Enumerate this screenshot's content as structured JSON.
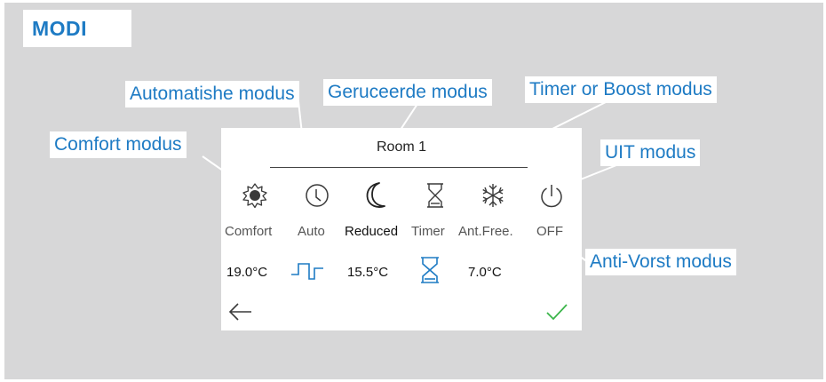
{
  "header": {
    "title": "MODI"
  },
  "callouts": {
    "comfort": "Comfort modus",
    "auto": "Automatishe modus",
    "reduced": "Geruceerde modus",
    "timer": "Timer or Boost modus",
    "off": "UIT modus",
    "antifrost": "Anti-Vorst modus"
  },
  "screen": {
    "room_title": "Room 1",
    "modes": [
      {
        "id": "comfort",
        "label": "Comfort",
        "icon": "sun-icon"
      },
      {
        "id": "auto",
        "label": "Auto",
        "icon": "clock-icon"
      },
      {
        "id": "reduced",
        "label": "Reduced",
        "icon": "moon-icon",
        "active": true
      },
      {
        "id": "timer",
        "label": "Timer",
        "icon": "hourglass-icon"
      },
      {
        "id": "antifrost",
        "label": "Ant.Free.",
        "icon": "snowflake-icon"
      },
      {
        "id": "off",
        "label": "OFF",
        "icon": "power-icon"
      }
    ],
    "temps": {
      "comfort": "19.0°C",
      "reduced": "15.5°C",
      "antifrost": "7.0°C"
    },
    "back_icon": "arrow-left-icon",
    "confirm_icon": "checkmark-icon"
  },
  "colors": {
    "accent": "#1e7bc4",
    "panel": "#d7d7d8",
    "confirm": "#3bb54a"
  }
}
